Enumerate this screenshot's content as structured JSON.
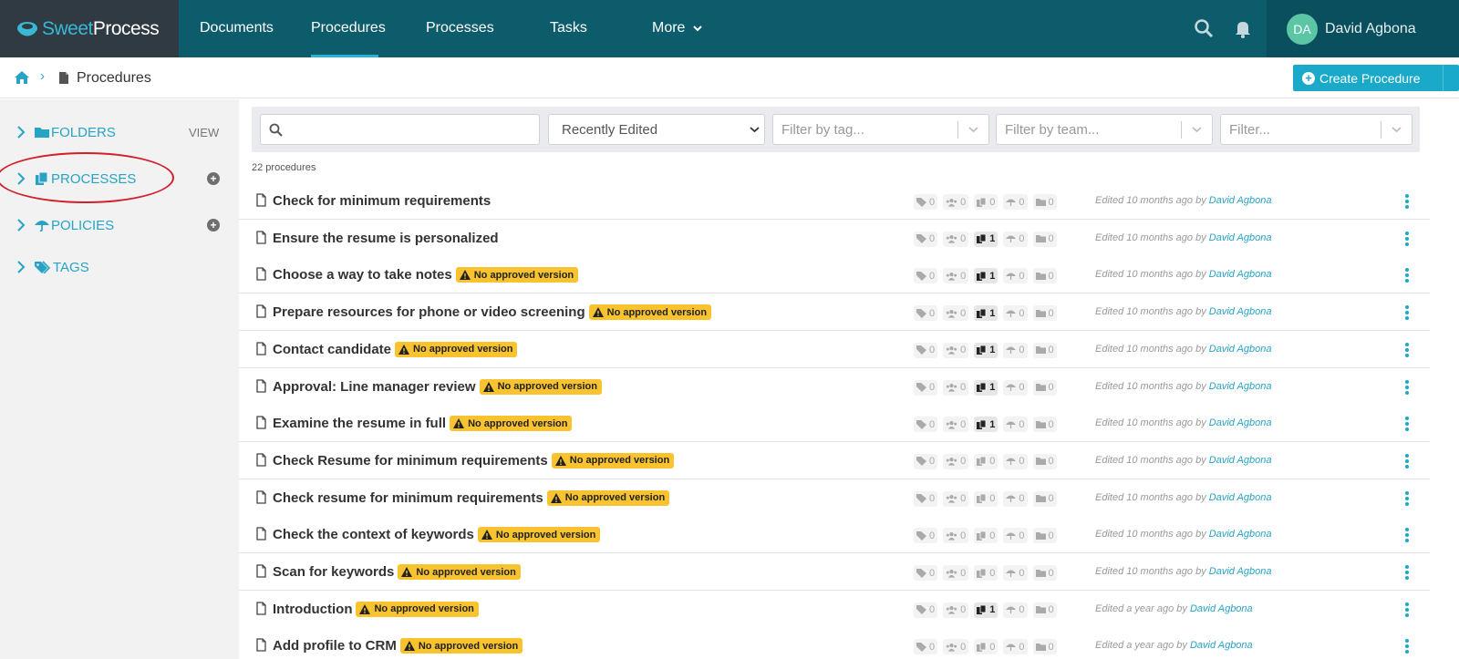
{
  "brand": {
    "sweet": "Sweet",
    "process": "Process"
  },
  "nav": {
    "items": [
      "Documents",
      "Procedures",
      "Processes",
      "Tasks",
      "More"
    ],
    "active": "Procedures"
  },
  "user": {
    "initials": "DA",
    "name": "David Agbona"
  },
  "breadcrumb": {
    "label": "Procedures"
  },
  "create_button": {
    "label": "Create Procedure"
  },
  "sidebar": {
    "items": [
      {
        "label": "FOLDERS",
        "icon": "folder-icon",
        "right": "VIEW"
      },
      {
        "label": "PROCESSES",
        "icon": "processes-icon",
        "right": "+"
      },
      {
        "label": "POLICIES",
        "icon": "umbrella-icon",
        "right": "+"
      },
      {
        "label": "TAGS",
        "icon": "tags-icon",
        "right": ""
      }
    ]
  },
  "filters": {
    "search_placeholder": "",
    "sort_value": "Recently Edited",
    "tag_placeholder": "Filter by tag...",
    "team_placeholder": "Filter by team...",
    "other_placeholder": "Filter..."
  },
  "count_label": "22 procedures",
  "badge_label": "No approved version",
  "colors": {
    "nav_bg": "#0c5c6c",
    "accent": "#27a3c6",
    "badge": "#f8c32f",
    "annotation": "#d0202a"
  },
  "rows": [
    {
      "title": "Check for minimum requirements",
      "badge": false,
      "tags": "0",
      "teams": "0",
      "processes": "0",
      "proc_hl": false,
      "policies": "0",
      "folders": "0",
      "edited": "Edited 10 months ago by",
      "author": "David Agbona"
    },
    {
      "title": "Ensure the resume is personalized",
      "badge": false,
      "tags": "0",
      "teams": "0",
      "processes": "1",
      "proc_hl": true,
      "policies": "0",
      "folders": "0",
      "edited": "Edited 10 months ago by",
      "author": "David Agbona"
    },
    {
      "title": "Choose a way to take notes",
      "badge": true,
      "tags": "0",
      "teams": "0",
      "processes": "1",
      "proc_hl": true,
      "policies": "0",
      "folders": "0",
      "edited": "Edited 10 months ago by",
      "author": "David Agbona"
    },
    {
      "title": "Prepare resources for phone or video screening",
      "badge": true,
      "tags": "0",
      "teams": "0",
      "processes": "1",
      "proc_hl": true,
      "policies": "0",
      "folders": "0",
      "edited": "Edited 10 months ago by",
      "author": "David Agbona"
    },
    {
      "title": "Contact candidate",
      "badge": true,
      "tags": "0",
      "teams": "0",
      "processes": "1",
      "proc_hl": true,
      "policies": "0",
      "folders": "0",
      "edited": "Edited 10 months ago by",
      "author": "David Agbona"
    },
    {
      "title": "Approval: Line manager review",
      "badge": true,
      "tags": "0",
      "teams": "0",
      "processes": "1",
      "proc_hl": true,
      "policies": "0",
      "folders": "0",
      "edited": "Edited 10 months ago by",
      "author": "David Agbona"
    },
    {
      "title": "Examine the resume in full",
      "badge": true,
      "tags": "0",
      "teams": "0",
      "processes": "1",
      "proc_hl": true,
      "policies": "0",
      "folders": "0",
      "edited": "Edited 10 months ago by",
      "author": "David Agbona"
    },
    {
      "title": "Check Resume for minimum requirements",
      "badge": true,
      "tags": "0",
      "teams": "0",
      "processes": "0",
      "proc_hl": false,
      "policies": "0",
      "folders": "0",
      "edited": "Edited 10 months ago by",
      "author": "David Agbona"
    },
    {
      "title": "Check resume for minimum requirements",
      "badge": true,
      "tags": "0",
      "teams": "0",
      "processes": "0",
      "proc_hl": false,
      "policies": "0",
      "folders": "0",
      "edited": "Edited 10 months ago by",
      "author": "David Agbona"
    },
    {
      "title": "Check the context of keywords",
      "badge": true,
      "tags": "0",
      "teams": "0",
      "processes": "0",
      "proc_hl": false,
      "policies": "0",
      "folders": "0",
      "edited": "Edited 10 months ago by",
      "author": "David Agbona"
    },
    {
      "title": "Scan for keywords",
      "badge": true,
      "tags": "0",
      "teams": "0",
      "processes": "0",
      "proc_hl": false,
      "policies": "0",
      "folders": "0",
      "edited": "Edited 10 months ago by",
      "author": "David Agbona"
    },
    {
      "title": "Introduction",
      "badge": true,
      "tags": "0",
      "teams": "0",
      "processes": "1",
      "proc_hl": true,
      "policies": "0",
      "folders": "0",
      "edited": "Edited a year ago by",
      "author": "David Agbona"
    },
    {
      "title": "Add profile to CRM",
      "badge": true,
      "tags": "0",
      "teams": "0",
      "processes": "0",
      "proc_hl": false,
      "policies": "0",
      "folders": "0",
      "edited": "Edited a year ago by",
      "author": "David Agbona"
    }
  ]
}
